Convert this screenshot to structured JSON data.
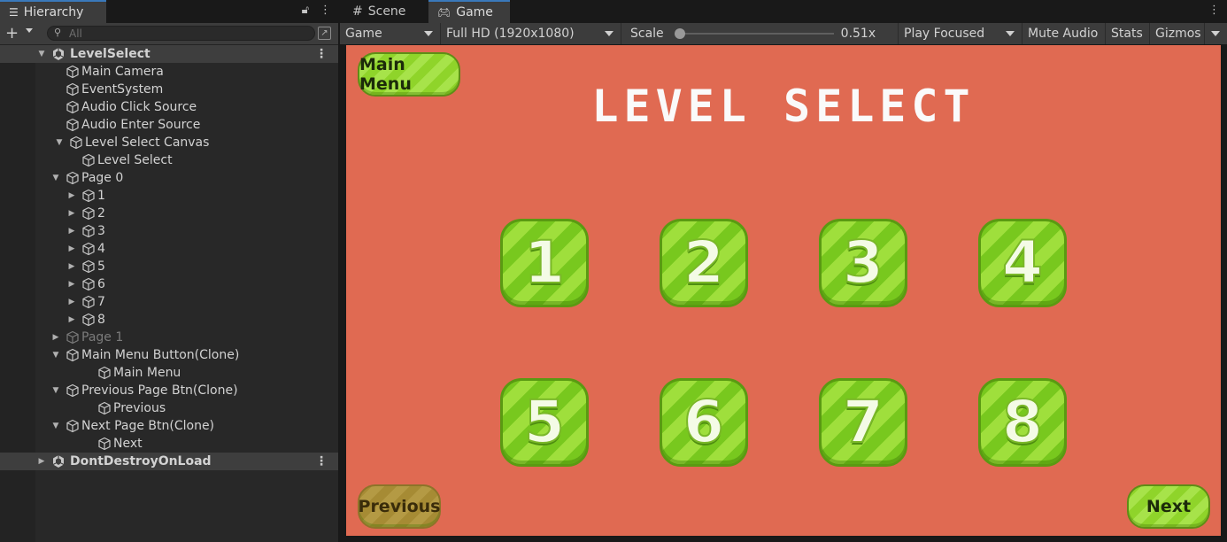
{
  "hierarchy": {
    "tab_label": "Hierarchy",
    "search_placeholder": "All",
    "rows": [
      {
        "label": "LevelSelect",
        "depth": 0,
        "type": "scene",
        "expanded": true
      },
      {
        "label": "Main Camera",
        "depth": 2,
        "type": "object"
      },
      {
        "label": "EventSystem",
        "depth": 2,
        "type": "object"
      },
      {
        "label": "Audio Click Source",
        "depth": 2,
        "type": "object"
      },
      {
        "label": "Audio Enter Source",
        "depth": 2,
        "type": "object"
      },
      {
        "label": "Level Select Canvas",
        "depth": 1,
        "type": "object",
        "expanded": true
      },
      {
        "label": "Level Select",
        "depth": 3,
        "type": "object"
      },
      {
        "label": "Page 0",
        "depth": 2,
        "type": "object",
        "expanded": true
      },
      {
        "label": "1",
        "depth": 3,
        "type": "object",
        "expanded": false
      },
      {
        "label": "2",
        "depth": 3,
        "type": "object",
        "expanded": false
      },
      {
        "label": "3",
        "depth": 3,
        "type": "object",
        "expanded": false
      },
      {
        "label": "4",
        "depth": 3,
        "type": "object",
        "expanded": false
      },
      {
        "label": "5",
        "depth": 3,
        "type": "object",
        "expanded": false
      },
      {
        "label": "6",
        "depth": 3,
        "type": "object",
        "expanded": false
      },
      {
        "label": "7",
        "depth": 3,
        "type": "object",
        "expanded": false
      },
      {
        "label": "8",
        "depth": 3,
        "type": "object",
        "expanded": false
      },
      {
        "label": "Page 1",
        "depth": 2,
        "type": "object",
        "expanded": false,
        "inactive": true
      },
      {
        "label": "Main Menu Button(Clone)",
        "depth": 2,
        "type": "object",
        "expanded": true
      },
      {
        "label": "Main Menu",
        "depth": 4,
        "type": "object"
      },
      {
        "label": "Previous Page Btn(Clone)",
        "depth": 2,
        "type": "object",
        "expanded": true
      },
      {
        "label": "Previous",
        "depth": 4,
        "type": "object"
      },
      {
        "label": "Next Page Btn(Clone)",
        "depth": 2,
        "type": "object",
        "expanded": true
      },
      {
        "label": "Next",
        "depth": 4,
        "type": "object"
      },
      {
        "label": "DontDestroyOnLoad",
        "depth": 0,
        "type": "scene",
        "expanded": false
      }
    ]
  },
  "game_view": {
    "tabs": {
      "scene": "Scene",
      "game": "Game"
    },
    "toolbar": {
      "display": "Game",
      "resolution": "Full HD (1920x1080)",
      "scale_label": "Scale",
      "scale_value": "0.51x",
      "scale_level": 0.0,
      "play_mode": "Play Focused",
      "mute": "Mute Audio",
      "stats": "Stats",
      "gizmos": "Gizmos"
    },
    "screen": {
      "background": "#e06a52",
      "title": "LEVEL SELECT",
      "main_menu": "Main Menu",
      "previous": "Previous",
      "next": "Next",
      "levels": [
        "1",
        "2",
        "3",
        "4",
        "5",
        "6",
        "7",
        "8"
      ]
    }
  }
}
